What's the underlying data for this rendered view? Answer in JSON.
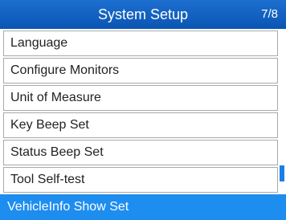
{
  "header": {
    "title": "System Setup",
    "page": "7/8"
  },
  "menu": {
    "items": [
      {
        "label": "Language",
        "selected": false
      },
      {
        "label": "Configure Monitors",
        "selected": false
      },
      {
        "label": "Unit of Measure",
        "selected": false
      },
      {
        "label": "Key Beep Set",
        "selected": false
      },
      {
        "label": "Status Beep Set",
        "selected": false
      },
      {
        "label": "Tool Self-test",
        "selected": false
      },
      {
        "label": "VehicleInfo Show Set",
        "selected": true
      }
    ]
  },
  "colors": {
    "header": "#0a55b3",
    "selected": "#1e8df0",
    "border": "#a9a9a9"
  }
}
